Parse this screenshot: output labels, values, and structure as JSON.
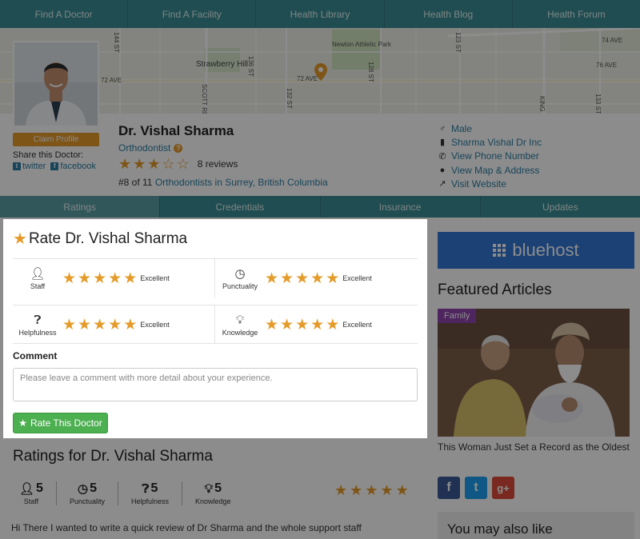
{
  "nav": {
    "items": [
      "Find A Doctor",
      "Find A Facility",
      "Health Library",
      "Health Blog",
      "Health Forum"
    ]
  },
  "map": {
    "labels": {
      "strawberry_hill": "Strawberry Hill",
      "newton_park": "Newton Athletic Park",
      "ave_72_left": "72 AVE",
      "ave_72_mid": "72 AVE",
      "ave_74": "74 AVE",
      "st_132": "132 ST",
      "st_128": "128 ST",
      "st_123": "123 ST",
      "st_144": "144 ST",
      "st_136": "136 ST",
      "st_130": "130 ST",
      "st_126": "126 ST",
      "scott_rd": "SCOTT RD",
      "king": "KING",
      "st_133": "133 ST",
      "ave_76": "76 AVE"
    }
  },
  "profile": {
    "claim_label": "Claim Profile",
    "share_label": "Share this Doctor:",
    "twitter_label": "twitter",
    "facebook_label": "facebook",
    "name": "Dr. Vishal Sharma",
    "specialty": "Orthodontist",
    "rating_filled": 3,
    "rating_max": 5,
    "reviews": "8 reviews",
    "rank_prefix": "#8 of 11",
    "rank_link": "Orthodontists in Surrey, British Columbia",
    "info": {
      "gender": "Male",
      "practice": "Sharma Vishal Dr Inc",
      "phone": "View Phone Number",
      "map": "View Map & Address",
      "website": "Visit Website"
    }
  },
  "tabs": [
    "Ratings",
    "Credentials",
    "Insurance",
    "Updates"
  ],
  "rate_form": {
    "title": "Rate Dr. Vishal Sharma",
    "criteria": [
      {
        "label": "Staff",
        "icon": "user-icon",
        "stars": 5,
        "value": "Excellent"
      },
      {
        "label": "Punctuality",
        "icon": "clock-icon",
        "stars": 5,
        "value": "Excellent"
      },
      {
        "label": "Helpfulness",
        "icon": "question-icon",
        "stars": 5,
        "value": "Excellent"
      },
      {
        "label": "Knowledge",
        "icon": "lightbulb-icon",
        "stars": 5,
        "value": "Excellent"
      }
    ],
    "comment_label": "Comment",
    "comment_placeholder": "Please leave a comment with more detail about your experience.",
    "submit_label": "Rate This Doctor"
  },
  "sidebar": {
    "ad_text": "bluehost",
    "featured_title": "Featured Articles",
    "article_category": "Family",
    "article_title": "This Woman Just Set a Record as the Oldest",
    "also_title": "You may also like"
  },
  "ratings_summary": {
    "title": "Ratings for Dr. Vishal Sharma",
    "items": [
      {
        "label": "Staff",
        "value": "5",
        "icon": "user-icon"
      },
      {
        "label": "Punctuality",
        "value": "5",
        "icon": "clock-icon"
      },
      {
        "label": "Helpfulness",
        "value": "5",
        "icon": "question-icon"
      },
      {
        "label": "Knowledge",
        "value": "5",
        "icon": "lightbulb-icon"
      }
    ],
    "overall_stars": 5,
    "review_text": "Hi There I wanted to write a quick review of Dr Sharma and the whole support staff"
  },
  "colors": {
    "teal": "#3a8d94",
    "star": "#e59b2a",
    "link": "#2d7ea3",
    "button_green": "#4caf50",
    "ad_blue": "#3377d6"
  }
}
